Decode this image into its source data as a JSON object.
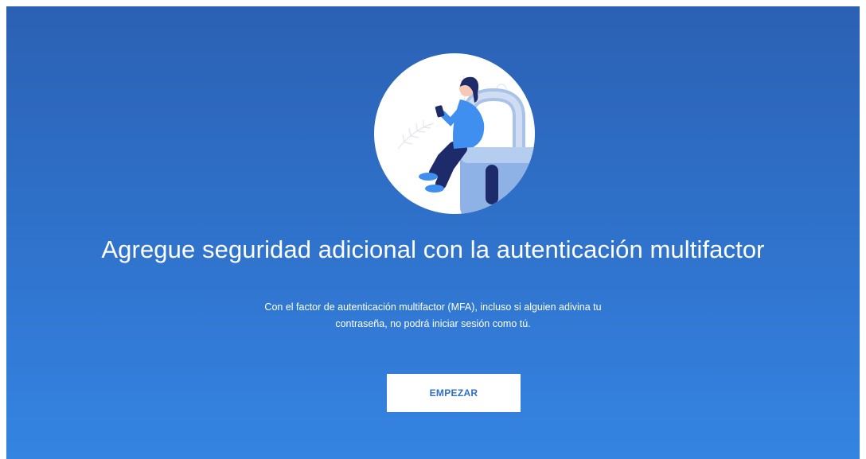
{
  "hero": {
    "illustration": "person-sitting-on-padlock-with-phone-illustration"
  },
  "title": "Agregue seguridad adicional con la autenticación multifactor",
  "description": {
    "line1": "Con el factor de autenticación multifactor (MFA), incluso si alguien adivina tu",
    "line2": "contraseña, no podrá iniciar sesión como tú."
  },
  "start_button": {
    "label": "EMPEZAR"
  },
  "colors": {
    "background_top": "#2b61b4",
    "background_bottom": "#3584e2",
    "button_text": "#2f6fcb",
    "illustration_accent": "#3f8ff0",
    "illustration_dark": "#1d2b6b"
  }
}
